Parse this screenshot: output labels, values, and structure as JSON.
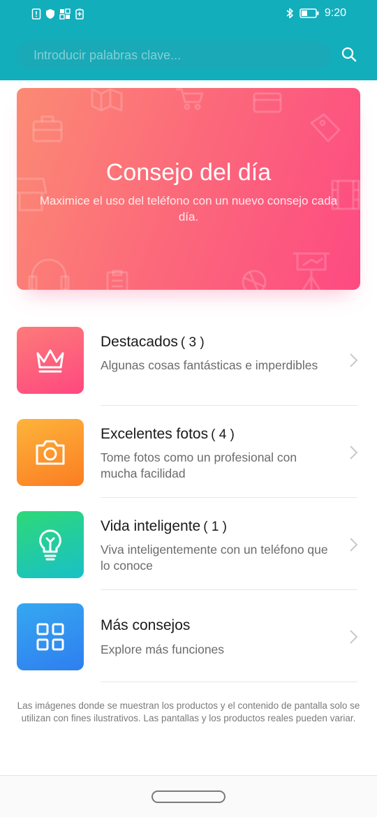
{
  "status_bar": {
    "time": "9:20",
    "left_icons": [
      "sim-alert-icon",
      "shield-icon",
      "app-grid-icon",
      "battery-saver-icon"
    ],
    "right_icons": [
      "bluetooth-icon",
      "battery-icon"
    ]
  },
  "search": {
    "placeholder": "Introducir palabras clave...",
    "value": "",
    "icon": "search-icon"
  },
  "banner": {
    "title": "Consejo del día",
    "subtitle": "Maximice el uso del teléfono con un nuevo consejo cada día."
  },
  "items": [
    {
      "title": "Destacados",
      "count": "( 3 )",
      "desc": "Algunas cosas fantásticas e imperdibles",
      "icon": "crown-icon",
      "color": "#fd5e7e"
    },
    {
      "title": "Excelentes fotos",
      "count": "( 4 )",
      "desc": "Tome fotos como un profesional con mucha facilidad",
      "icon": "camera-icon",
      "color": "#fc9a2e"
    },
    {
      "title": "Vida inteligente",
      "count": "( 1 )",
      "desc": "Viva inteligentemente con un teléfono que lo conoce",
      "icon": "lightbulb-icon",
      "color": "#22cca0"
    },
    {
      "title": "Más consejos",
      "count": "",
      "desc": "Explore más funciones",
      "icon": "grid-icon",
      "color": "#3294f0"
    }
  ],
  "disclaimer": "Las imágenes donde se muestran los productos y el contenido de pantalla solo se utilizan con fines ilustrativos. Las pantallas y los productos reales pueden variar.",
  "colors": {
    "header": "#12aebc",
    "banner_start": "#fb8a74",
    "banner_end": "#fd4a82"
  }
}
